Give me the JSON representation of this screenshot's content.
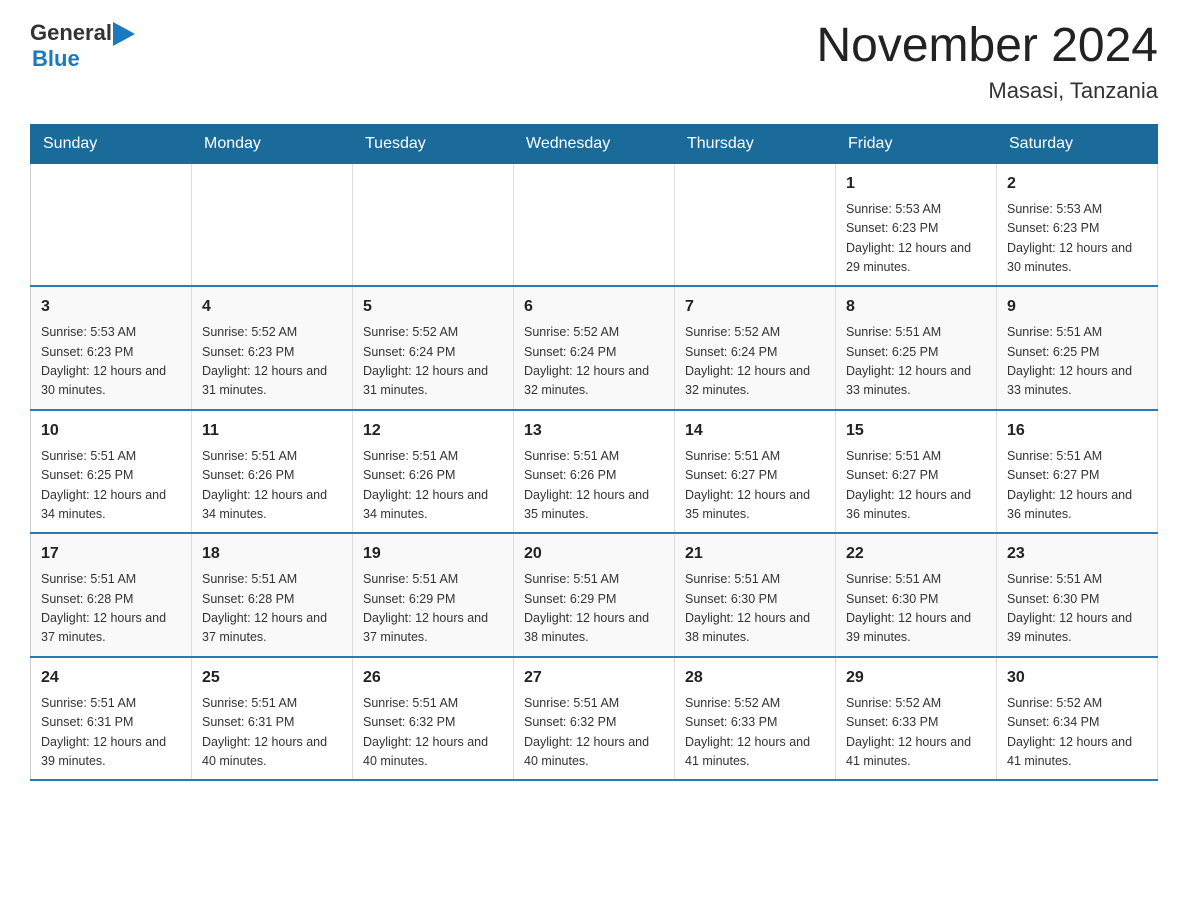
{
  "header": {
    "logo_general": "General",
    "logo_blue": "Blue",
    "title": "November 2024",
    "location": "Masasi, Tanzania"
  },
  "days_header": [
    "Sunday",
    "Monday",
    "Tuesday",
    "Wednesday",
    "Thursday",
    "Friday",
    "Saturday"
  ],
  "weeks": [
    [
      {
        "day": "",
        "sunrise": "",
        "sunset": "",
        "daylight": ""
      },
      {
        "day": "",
        "sunrise": "",
        "sunset": "",
        "daylight": ""
      },
      {
        "day": "",
        "sunrise": "",
        "sunset": "",
        "daylight": ""
      },
      {
        "day": "",
        "sunrise": "",
        "sunset": "",
        "daylight": ""
      },
      {
        "day": "",
        "sunrise": "",
        "sunset": "",
        "daylight": ""
      },
      {
        "day": "1",
        "sunrise": "Sunrise: 5:53 AM",
        "sunset": "Sunset: 6:23 PM",
        "daylight": "Daylight: 12 hours and 29 minutes."
      },
      {
        "day": "2",
        "sunrise": "Sunrise: 5:53 AM",
        "sunset": "Sunset: 6:23 PM",
        "daylight": "Daylight: 12 hours and 30 minutes."
      }
    ],
    [
      {
        "day": "3",
        "sunrise": "Sunrise: 5:53 AM",
        "sunset": "Sunset: 6:23 PM",
        "daylight": "Daylight: 12 hours and 30 minutes."
      },
      {
        "day": "4",
        "sunrise": "Sunrise: 5:52 AM",
        "sunset": "Sunset: 6:23 PM",
        "daylight": "Daylight: 12 hours and 31 minutes."
      },
      {
        "day": "5",
        "sunrise": "Sunrise: 5:52 AM",
        "sunset": "Sunset: 6:24 PM",
        "daylight": "Daylight: 12 hours and 31 minutes."
      },
      {
        "day": "6",
        "sunrise": "Sunrise: 5:52 AM",
        "sunset": "Sunset: 6:24 PM",
        "daylight": "Daylight: 12 hours and 32 minutes."
      },
      {
        "day": "7",
        "sunrise": "Sunrise: 5:52 AM",
        "sunset": "Sunset: 6:24 PM",
        "daylight": "Daylight: 12 hours and 32 minutes."
      },
      {
        "day": "8",
        "sunrise": "Sunrise: 5:51 AM",
        "sunset": "Sunset: 6:25 PM",
        "daylight": "Daylight: 12 hours and 33 minutes."
      },
      {
        "day": "9",
        "sunrise": "Sunrise: 5:51 AM",
        "sunset": "Sunset: 6:25 PM",
        "daylight": "Daylight: 12 hours and 33 minutes."
      }
    ],
    [
      {
        "day": "10",
        "sunrise": "Sunrise: 5:51 AM",
        "sunset": "Sunset: 6:25 PM",
        "daylight": "Daylight: 12 hours and 34 minutes."
      },
      {
        "day": "11",
        "sunrise": "Sunrise: 5:51 AM",
        "sunset": "Sunset: 6:26 PM",
        "daylight": "Daylight: 12 hours and 34 minutes."
      },
      {
        "day": "12",
        "sunrise": "Sunrise: 5:51 AM",
        "sunset": "Sunset: 6:26 PM",
        "daylight": "Daylight: 12 hours and 34 minutes."
      },
      {
        "day": "13",
        "sunrise": "Sunrise: 5:51 AM",
        "sunset": "Sunset: 6:26 PM",
        "daylight": "Daylight: 12 hours and 35 minutes."
      },
      {
        "day": "14",
        "sunrise": "Sunrise: 5:51 AM",
        "sunset": "Sunset: 6:27 PM",
        "daylight": "Daylight: 12 hours and 35 minutes."
      },
      {
        "day": "15",
        "sunrise": "Sunrise: 5:51 AM",
        "sunset": "Sunset: 6:27 PM",
        "daylight": "Daylight: 12 hours and 36 minutes."
      },
      {
        "day": "16",
        "sunrise": "Sunrise: 5:51 AM",
        "sunset": "Sunset: 6:27 PM",
        "daylight": "Daylight: 12 hours and 36 minutes."
      }
    ],
    [
      {
        "day": "17",
        "sunrise": "Sunrise: 5:51 AM",
        "sunset": "Sunset: 6:28 PM",
        "daylight": "Daylight: 12 hours and 37 minutes."
      },
      {
        "day": "18",
        "sunrise": "Sunrise: 5:51 AM",
        "sunset": "Sunset: 6:28 PM",
        "daylight": "Daylight: 12 hours and 37 minutes."
      },
      {
        "day": "19",
        "sunrise": "Sunrise: 5:51 AM",
        "sunset": "Sunset: 6:29 PM",
        "daylight": "Daylight: 12 hours and 37 minutes."
      },
      {
        "day": "20",
        "sunrise": "Sunrise: 5:51 AM",
        "sunset": "Sunset: 6:29 PM",
        "daylight": "Daylight: 12 hours and 38 minutes."
      },
      {
        "day": "21",
        "sunrise": "Sunrise: 5:51 AM",
        "sunset": "Sunset: 6:30 PM",
        "daylight": "Daylight: 12 hours and 38 minutes."
      },
      {
        "day": "22",
        "sunrise": "Sunrise: 5:51 AM",
        "sunset": "Sunset: 6:30 PM",
        "daylight": "Daylight: 12 hours and 39 minutes."
      },
      {
        "day": "23",
        "sunrise": "Sunrise: 5:51 AM",
        "sunset": "Sunset: 6:30 PM",
        "daylight": "Daylight: 12 hours and 39 minutes."
      }
    ],
    [
      {
        "day": "24",
        "sunrise": "Sunrise: 5:51 AM",
        "sunset": "Sunset: 6:31 PM",
        "daylight": "Daylight: 12 hours and 39 minutes."
      },
      {
        "day": "25",
        "sunrise": "Sunrise: 5:51 AM",
        "sunset": "Sunset: 6:31 PM",
        "daylight": "Daylight: 12 hours and 40 minutes."
      },
      {
        "day": "26",
        "sunrise": "Sunrise: 5:51 AM",
        "sunset": "Sunset: 6:32 PM",
        "daylight": "Daylight: 12 hours and 40 minutes."
      },
      {
        "day": "27",
        "sunrise": "Sunrise: 5:51 AM",
        "sunset": "Sunset: 6:32 PM",
        "daylight": "Daylight: 12 hours and 40 minutes."
      },
      {
        "day": "28",
        "sunrise": "Sunrise: 5:52 AM",
        "sunset": "Sunset: 6:33 PM",
        "daylight": "Daylight: 12 hours and 41 minutes."
      },
      {
        "day": "29",
        "sunrise": "Sunrise: 5:52 AM",
        "sunset": "Sunset: 6:33 PM",
        "daylight": "Daylight: 12 hours and 41 minutes."
      },
      {
        "day": "30",
        "sunrise": "Sunrise: 5:52 AM",
        "sunset": "Sunset: 6:34 PM",
        "daylight": "Daylight: 12 hours and 41 minutes."
      }
    ]
  ]
}
